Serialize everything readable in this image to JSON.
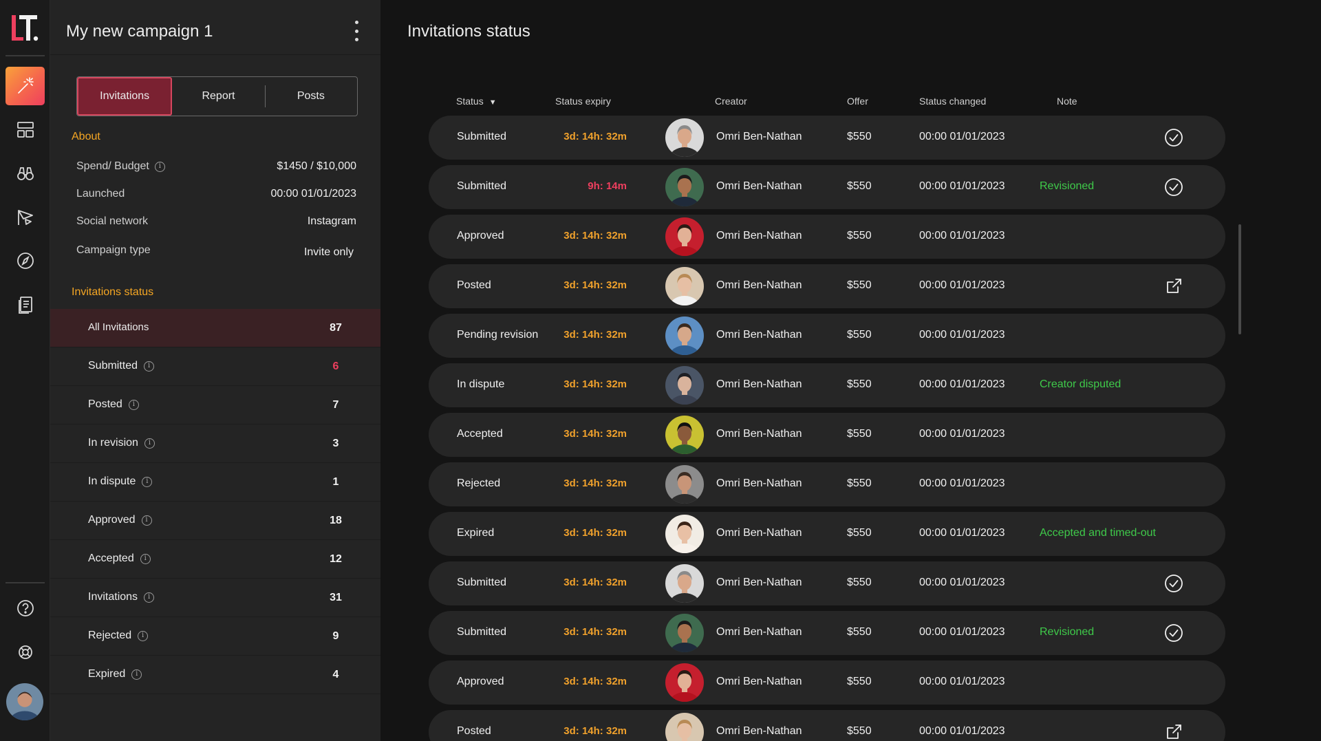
{
  "rail": {
    "logo_text": "LT.",
    "items": [
      {
        "name": "magic-wand",
        "active": true
      },
      {
        "name": "dashboard",
        "active": false
      },
      {
        "name": "binoculars",
        "active": false
      },
      {
        "name": "campaign-flag",
        "active": false
      },
      {
        "name": "compass",
        "active": false
      },
      {
        "name": "documents",
        "active": false
      }
    ],
    "bottom_items": [
      "help",
      "support"
    ]
  },
  "campaign": {
    "title": "My new campaign 1",
    "tabs": [
      {
        "label": "Invitations",
        "active": true
      },
      {
        "label": "Report",
        "active": false
      },
      {
        "label": "Posts",
        "active": false
      }
    ],
    "about_heading": "About",
    "about": [
      {
        "label": "Spend/ Budget",
        "value": "$1450 / $10,000",
        "info": true
      },
      {
        "label": "Launched",
        "value": "00:00 01/01/2023",
        "info": false
      },
      {
        "label": "Social network",
        "value": "Instagram",
        "info": false
      },
      {
        "label": "Campaign type",
        "value": "Invite only",
        "info": false
      }
    ],
    "status_heading": "Invitations status",
    "statuses": [
      {
        "label": "All Invitations",
        "count": "87",
        "active": true,
        "info": false,
        "highlight": false
      },
      {
        "label": "Submitted",
        "count": "6",
        "active": false,
        "info": true,
        "highlight": true
      },
      {
        "label": "Posted",
        "count": "7",
        "active": false,
        "info": true,
        "highlight": false
      },
      {
        "label": "In revision",
        "count": "3",
        "active": false,
        "info": true,
        "highlight": false
      },
      {
        "label": "In dispute",
        "count": "1",
        "active": false,
        "info": true,
        "highlight": false
      },
      {
        "label": "Approved",
        "count": "18",
        "active": false,
        "info": true,
        "highlight": false
      },
      {
        "label": "Accepted",
        "count": "12",
        "active": false,
        "info": true,
        "highlight": false
      },
      {
        "label": "Invitations",
        "count": "31",
        "active": false,
        "info": true,
        "highlight": false
      },
      {
        "label": "Rejected",
        "count": "9",
        "active": false,
        "info": true,
        "highlight": false
      },
      {
        "label": "Expired",
        "count": "4",
        "active": false,
        "info": true,
        "highlight": false
      }
    ]
  },
  "main": {
    "title": "Invitations status",
    "columns": {
      "status": "Status",
      "status_expiry": "Status expiry",
      "creator": "Creator",
      "offer": "Offer",
      "status_changed": "Status changed",
      "note": "Note"
    },
    "sort_indicator": "▼",
    "rows": [
      {
        "status": "Submitted",
        "expiry": "3d: 14h: 32m",
        "urgent": false,
        "creator": "Omri Ben-Nathan",
        "offer": "$550",
        "changed": "00:00 01/01/2023",
        "note": "",
        "action": "check",
        "avatar": "man-grey"
      },
      {
        "status": "Submitted",
        "expiry": "9h: 14m",
        "urgent": true,
        "creator": "Omri Ben-Nathan",
        "offer": "$550",
        "changed": "00:00 01/01/2023",
        "note": "Revisioned",
        "action": "check",
        "avatar": "man-green"
      },
      {
        "status": "Approved",
        "expiry": "3d: 14h: 32m",
        "urgent": false,
        "creator": "Omri Ben-Nathan",
        "offer": "$550",
        "changed": "00:00 01/01/2023",
        "note": "",
        "action": "",
        "avatar": "woman-red"
      },
      {
        "status": "Posted",
        "expiry": "3d: 14h: 32m",
        "urgent": false,
        "creator": "Omri Ben-Nathan",
        "offer": "$550",
        "changed": "00:00 01/01/2023",
        "note": "",
        "action": "external",
        "avatar": "woman-blonde"
      },
      {
        "status": "Pending revision",
        "expiry": "3d: 14h: 32m",
        "urgent": false,
        "creator": "Omri Ben-Nathan",
        "offer": "$550",
        "changed": "00:00 01/01/2023",
        "note": "",
        "action": "",
        "avatar": "man-blue"
      },
      {
        "status": "In dispute",
        "expiry": "3d: 14h: 32m",
        "urgent": false,
        "creator": "Omri Ben-Nathan",
        "offer": "$550",
        "changed": "00:00 01/01/2023",
        "note": "Creator disputed",
        "action": "",
        "avatar": "woman-hat"
      },
      {
        "status": "Accepted",
        "expiry": "3d: 14h: 32m",
        "urgent": false,
        "creator": "Omri Ben-Nathan",
        "offer": "$550",
        "changed": "00:00 01/01/2023",
        "note": "",
        "action": "",
        "avatar": "man-yellow"
      },
      {
        "status": "Rejected",
        "expiry": "3d: 14h: 32m",
        "urgent": false,
        "creator": "Omri Ben-Nathan",
        "offer": "$550",
        "changed": "00:00 01/01/2023",
        "note": "",
        "action": "",
        "avatar": "man-glasses"
      },
      {
        "status": "Expired",
        "expiry": "3d: 14h: 32m",
        "urgent": false,
        "creator": "Omri Ben-Nathan",
        "offer": "$550",
        "changed": "00:00 01/01/2023",
        "note": "Accepted and timed-out",
        "action": "",
        "avatar": "woman-light"
      },
      {
        "status": "Submitted",
        "expiry": "3d: 14h: 32m",
        "urgent": false,
        "creator": "Omri Ben-Nathan",
        "offer": "$550",
        "changed": "00:00 01/01/2023",
        "note": "",
        "action": "check",
        "avatar": "man-grey"
      },
      {
        "status": "Submitted",
        "expiry": "3d: 14h: 32m",
        "urgent": false,
        "creator": "Omri Ben-Nathan",
        "offer": "$550",
        "changed": "00:00 01/01/2023",
        "note": "Revisioned",
        "action": "check",
        "avatar": "man-green"
      },
      {
        "status": "Approved",
        "expiry": "3d: 14h: 32m",
        "urgent": false,
        "creator": "Omri Ben-Nathan",
        "offer": "$550",
        "changed": "00:00 01/01/2023",
        "note": "",
        "action": "",
        "avatar": "woman-red"
      },
      {
        "status": "Posted",
        "expiry": "3d: 14h: 32m",
        "urgent": false,
        "creator": "Omri Ben-Nathan",
        "offer": "$550",
        "changed": "00:00 01/01/2023",
        "note": "",
        "action": "external",
        "avatar": "woman-blonde"
      }
    ]
  },
  "colors": {
    "accent_orange": "#f5a623",
    "accent_red": "#ee3f5e",
    "note_green": "#3fca4a",
    "tab_active_bg": "#7a2131"
  }
}
